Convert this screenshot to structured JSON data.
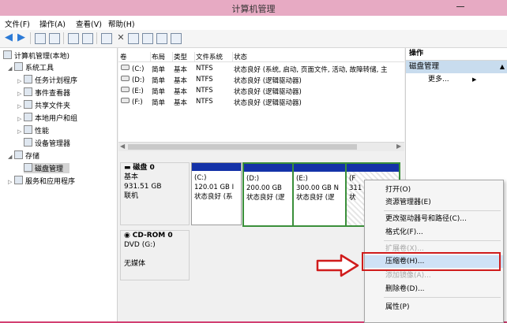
{
  "window": {
    "title": "计算机管理"
  },
  "menu": [
    "文件(F)",
    "操作(A)",
    "查看(V)",
    "帮助(H)"
  ],
  "tree": {
    "root": "计算机管理(本地)",
    "items": [
      "系统工具",
      "任务计划程序",
      "事件查看器",
      "共享文件夹",
      "本地用户和组",
      "性能",
      "设备管理器",
      "存储",
      "磁盘管理",
      "服务和应用程序"
    ]
  },
  "volumes": {
    "columns": [
      "卷",
      "布局",
      "类型",
      "文件系统",
      "状态"
    ],
    "rows": [
      [
        "(C:)",
        "简单",
        "基本",
        "NTFS",
        "状态良好 (系统, 启动, 页面文件, 活动, 故障转储, 主"
      ],
      [
        "(D:)",
        "简单",
        "基本",
        "NTFS",
        "状态良好 (逻辑驱动器)"
      ],
      [
        "(E:)",
        "简单",
        "基本",
        "NTFS",
        "状态良好 (逻辑驱动器)"
      ],
      [
        "(F:)",
        "简单",
        "基本",
        "NTFS",
        "状态良好 (逻辑驱动器)"
      ]
    ]
  },
  "disk0": {
    "name": "磁盘 0",
    "type": "基本",
    "size": "931.51 GB",
    "status": "联机",
    "partitions": [
      {
        "label": "(C:)",
        "size": "120.01 GB I",
        "status": "状态良好 (系"
      },
      {
        "label": "(D:)",
        "size": "200.00 GB",
        "status": "状态良好 (逻"
      },
      {
        "label": "(E:)",
        "size": "300.00 GB N",
        "status": "状态良好 (逻"
      },
      {
        "label": "(F",
        "size": "311",
        "status": "状"
      }
    ]
  },
  "cdrom": {
    "name": "CD-ROM 0",
    "drive": "DVD (G:)",
    "media": "无媒体"
  },
  "actions": {
    "header": "操作",
    "section": "磁盘管理",
    "more": "更多..."
  },
  "context_menu": [
    {
      "label": "打开(O)",
      "disabled": false
    },
    {
      "label": "资源管理器(E)",
      "disabled": false
    },
    {
      "label": "更改驱动器号和路径(C)...",
      "disabled": false
    },
    {
      "label": "格式化(F)...",
      "disabled": false
    },
    {
      "label": "扩展卷(X)...",
      "disabled": true
    },
    {
      "label": "压缩卷(H)...",
      "disabled": false
    },
    {
      "label": "添加镜像(A)...",
      "disabled": true
    },
    {
      "label": "删除卷(D)...",
      "disabled": false
    },
    {
      "label": "属性(P)",
      "disabled": false
    }
  ],
  "colors": {
    "title_bar": "#e7aac3",
    "partition_bar": "#1432a8",
    "highlight": "#cfe2f6",
    "annotation": "#d01c1c"
  }
}
